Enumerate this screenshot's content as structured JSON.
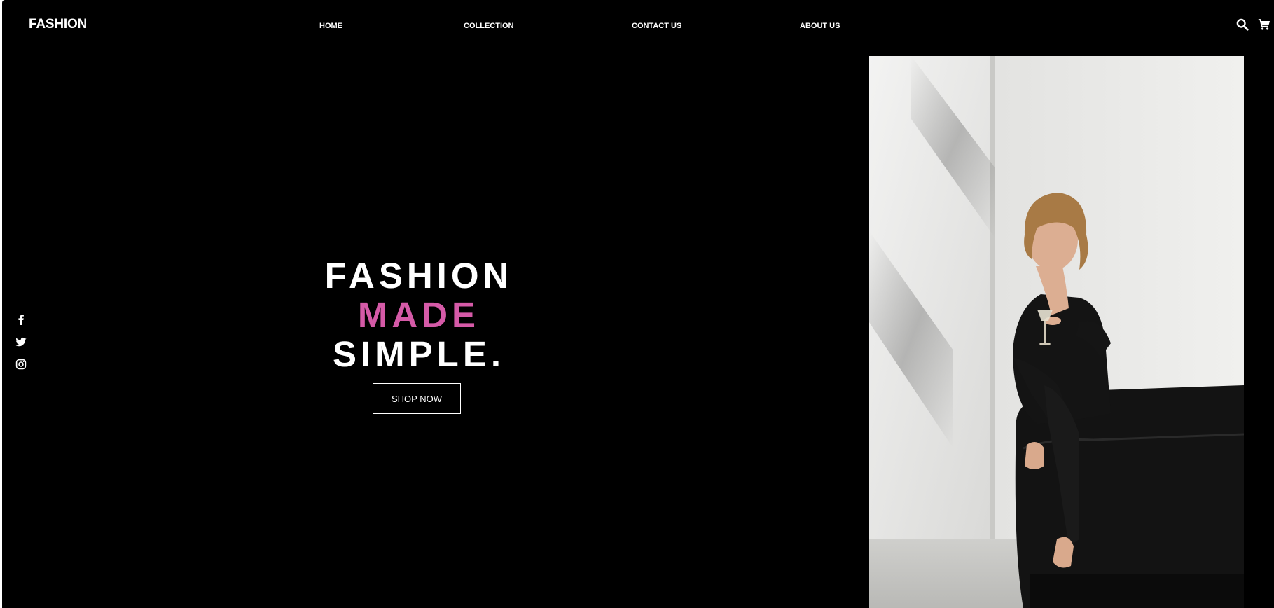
{
  "brand": {
    "logo": "FASHION"
  },
  "nav": {
    "items": [
      {
        "label": "HOME"
      },
      {
        "label": "COLLECTION"
      },
      {
        "label": "CONTACT US"
      },
      {
        "label": "ABOUT US"
      }
    ]
  },
  "header_icons": [
    "search-icon",
    "cart-icon"
  ],
  "social_icons": [
    "facebook-icon",
    "twitter-icon",
    "instagram-icon"
  ],
  "hero": {
    "line1": "FASHION",
    "line2": "MADE",
    "line3": "SIMPLE.",
    "cta_label": "SHOP NOW"
  },
  "colors": {
    "background": "#000000",
    "text": "#ffffff",
    "accent": "#d55aa7"
  }
}
